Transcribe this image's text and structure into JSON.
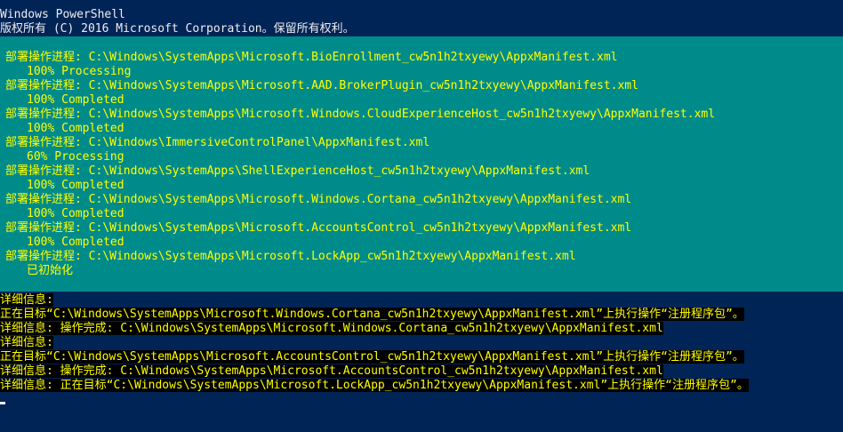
{
  "header": {
    "title": "Windows PowerShell",
    "copyright": "版权所有 (C) 2016 Microsoft Corporation。保留所有权利。"
  },
  "progress": {
    "entries": [
      {
        "operation": "部署操作进程: C:\\Windows\\SystemApps\\Microsoft.BioEnrollment_cw5n1h2txyewy\\AppxManifest.xml",
        "status": "100% Processing"
      },
      {
        "operation": "部署操作进程: C:\\Windows\\SystemApps\\Microsoft.AAD.BrokerPlugin_cw5n1h2txyewy\\AppxManifest.xml",
        "status": "100% Completed"
      },
      {
        "operation": "部署操作进程: C:\\Windows\\SystemApps\\Microsoft.Windows.CloudExperienceHost_cw5n1h2txyewy\\AppxManifest.xml",
        "status": "100% Completed"
      },
      {
        "operation": "部署操作进程: C:\\Windows\\ImmersiveControlPanel\\AppxManifest.xml",
        "status": "60% Processing"
      },
      {
        "operation": "部署操作进程: C:\\Windows\\SystemApps\\ShellExperienceHost_cw5n1h2txyewy\\AppxManifest.xml",
        "status": "100% Completed"
      },
      {
        "operation": "部署操作进程: C:\\Windows\\SystemApps\\Microsoft.Windows.Cortana_cw5n1h2txyewy\\AppxManifest.xml",
        "status": "100% Completed"
      },
      {
        "operation": "部署操作进程: C:\\Windows\\SystemApps\\Microsoft.AccountsControl_cw5n1h2txyewy\\AppxManifest.xml",
        "status": "100% Completed"
      },
      {
        "operation": "部署操作进程: C:\\Windows\\SystemApps\\Microsoft.LockApp_cw5n1h2txyewy\\AppxManifest.xml",
        "status": "已初始化"
      }
    ]
  },
  "verbose": {
    "lines": [
      "详细信息:",
      "正在目标“C:\\Windows\\SystemApps\\Microsoft.Windows.Cortana_cw5n1h2txyewy\\AppxManifest.xml”上执行操作“注册程序包”。",
      "详细信息: 操作完成: C:\\Windows\\SystemApps\\Microsoft.Windows.Cortana_cw5n1h2txyewy\\AppxManifest.xml",
      "详细信息:",
      "正在目标“C:\\Windows\\SystemApps\\Microsoft.AccountsControl_cw5n1h2txyewy\\AppxManifest.xml”上执行操作“注册程序包”。",
      "详细信息: 操作完成: C:\\Windows\\SystemApps\\Microsoft.AccountsControl_cw5n1h2txyewy\\AppxManifest.xml",
      "详细信息: 正在目标“C:\\Windows\\SystemApps\\Microsoft.LockApp_cw5n1h2txyewy\\AppxManifest.xml”上执行操作“注册程序包”。"
    ]
  },
  "colors": {
    "background": "#012456",
    "text": "#eeedf0",
    "progress_background": "#008b8b",
    "progress_text": "#ffff00",
    "verbose_text": "#ffff00",
    "verbose_background": "#000000"
  }
}
